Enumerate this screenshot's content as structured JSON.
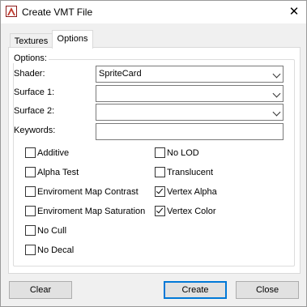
{
  "window": {
    "title": "Create VMT File",
    "close_glyph": "✕",
    "icon": "app-icon"
  },
  "tabs": {
    "textures": "Textures",
    "options": "Options",
    "selected": "Options"
  },
  "options_group": {
    "label": "Options:"
  },
  "fields": {
    "shader_label": "Shader:",
    "shader_value": "SpriteCard",
    "surface1_label": "Surface 1:",
    "surface1_value": "",
    "surface2_label": "Surface 2:",
    "surface2_value": "",
    "keywords_label": "Keywords:",
    "keywords_value": ""
  },
  "checkboxes": {
    "additive": {
      "label": "Additive",
      "checked": false
    },
    "alpha_test": {
      "label": "Alpha Test",
      "checked": false
    },
    "env_map_contrast": {
      "label": "Enviroment Map Contrast",
      "checked": false
    },
    "env_map_saturation": {
      "label": "Enviroment Map Saturation",
      "checked": false
    },
    "no_cull": {
      "label": "No Cull",
      "checked": false
    },
    "no_decal": {
      "label": "No Decal",
      "checked": false
    },
    "no_lod": {
      "label": "No LOD",
      "checked": false
    },
    "translucent": {
      "label": "Translucent",
      "checked": false
    },
    "vertex_alpha": {
      "label": "Vertex Alpha",
      "checked": true
    },
    "vertex_color": {
      "label": "Vertex Color",
      "checked": true
    }
  },
  "buttons": {
    "clear": "Clear",
    "create": "Create",
    "close": "Close"
  },
  "colors": {
    "accent": "#0078d7",
    "panel": "#ffffff",
    "chrome": "#f0f0f0"
  }
}
